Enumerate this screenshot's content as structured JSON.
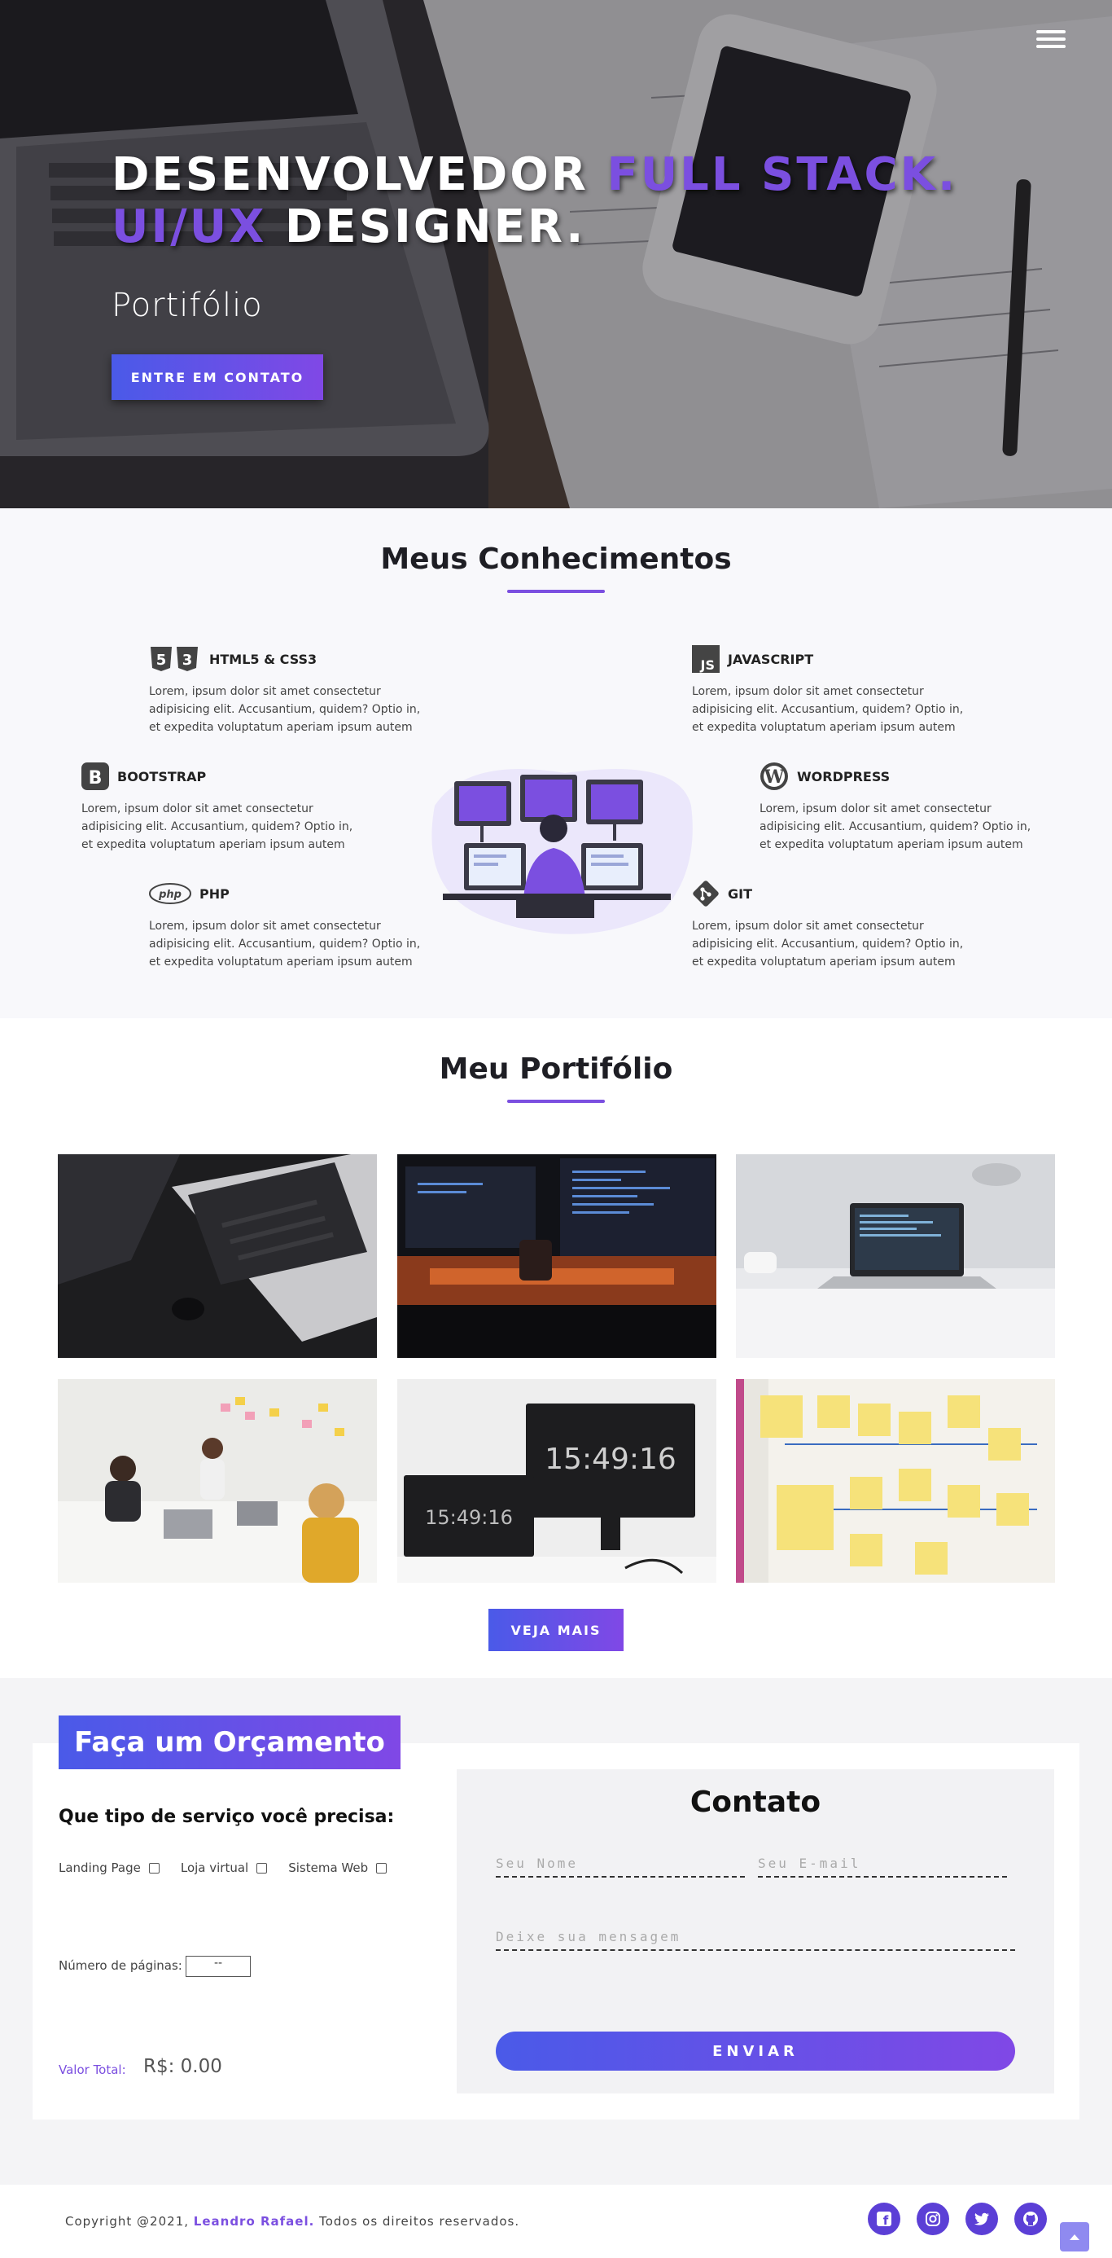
{
  "hero": {
    "title_part1": "DESENVOLVEDOR ",
    "title_accent1": "FULL STACK.",
    "title_accent2": "UI/UX",
    "title_part2": " DESIGNER.",
    "subtitle": "Portifólio",
    "cta_label": "ENTRE EM CONTATO",
    "menu_icon": "hamburger-icon"
  },
  "skills": {
    "title": "Meus Conhecimentos",
    "items": [
      {
        "name": "HTML5 & CSS3",
        "icon": "html5-css3-icon",
        "text": "Lorem, ipsum dolor sit amet consectetur adipisicing elit. Accusantium, quidem? Optio in, et expedita voluptatum aperiam ipsum autem"
      },
      {
        "name": "JAVASCRIPT",
        "icon": "javascript-icon",
        "text": "Lorem, ipsum dolor sit amet consectetur adipisicing elit. Accusantium, quidem? Optio in, et expedita voluptatum aperiam ipsum autem"
      },
      {
        "name": "BOOTSTRAP",
        "icon": "bootstrap-icon",
        "text": "Lorem, ipsum dolor sit amet consectetur adipisicing elit. Accusantium, quidem? Optio in, et expedita voluptatum aperiam ipsum autem"
      },
      {
        "name": "WORDPRESS",
        "icon": "wordpress-icon",
        "text": "Lorem, ipsum dolor sit amet consectetur adipisicing elit. Accusantium, quidem? Optio in, et expedita voluptatum aperiam ipsum autem"
      },
      {
        "name": "PHP",
        "icon": "php-icon",
        "text": "Lorem, ipsum dolor sit amet consectetur adipisicing elit. Accusantium, quidem? Optio in, et expedita voluptatum aperiam ipsum autem"
      },
      {
        "name": "GIT",
        "icon": "git-icon",
        "text": "Lorem, ipsum dolor sit amet consectetur adipisicing elit. Accusantium, quidem? Optio in, et expedita voluptatum aperiam ipsum autem"
      }
    ]
  },
  "portfolio": {
    "title": "Meu Portifólio",
    "clock_large": "15:49:16",
    "clock_small": "15:49:16",
    "see_more": "VEJA MAIS"
  },
  "quote": {
    "badge": "Faça um Orçamento",
    "question": "Que tipo de serviço você precisa:",
    "options": [
      "Landing Page",
      "Loja virtual",
      "Sistema Web"
    ],
    "pages_label": "Número de páginas:",
    "pages_value": "--",
    "total_label": "Valor Total:",
    "total_value": "R$: 0.00"
  },
  "contact": {
    "title": "Contato",
    "name_placeholder": "Seu Nome",
    "email_placeholder": "Seu E-mail",
    "message_placeholder": "Deixe sua mensagem",
    "send_label": "ENVIAR"
  },
  "footer": {
    "copy_prefix": "Copyright @2021, ",
    "author": "Leandro Rafael.",
    "copy_suffix": " Todos os direitos reservados.",
    "social": [
      "facebook-icon",
      "instagram-icon",
      "twitter-icon",
      "github-icon"
    ],
    "accent": "#7b4fe0"
  }
}
